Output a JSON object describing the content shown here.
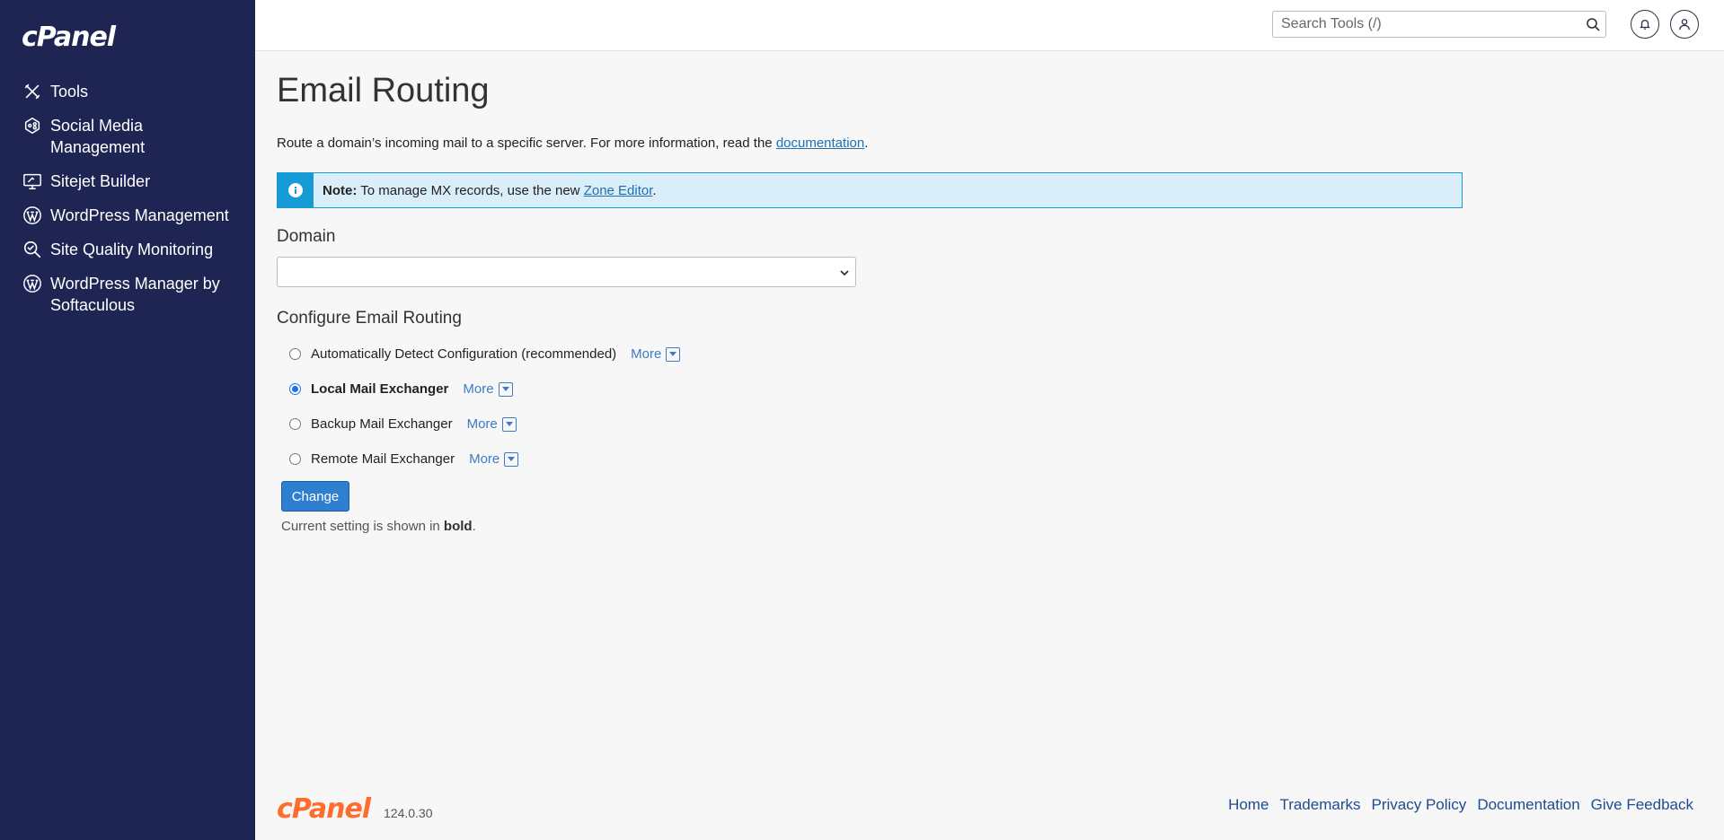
{
  "sidebar": {
    "brand": "cPanel",
    "items": [
      {
        "label": "Tools",
        "icon": "tools-icon"
      },
      {
        "label": "Social Media Management",
        "icon": "social-media-icon"
      },
      {
        "label": "Sitejet Builder",
        "icon": "sitejet-icon"
      },
      {
        "label": "WordPress Management",
        "icon": "wordpress-icon"
      },
      {
        "label": "Site Quality Monitoring",
        "icon": "site-quality-icon"
      },
      {
        "label": "WordPress Manager by Softaculous",
        "icon": "wordpress-icon"
      }
    ]
  },
  "topbar": {
    "search_placeholder": "Search Tools (/)",
    "search_value": ""
  },
  "main": {
    "title": "Email Routing",
    "intro_text": "Route a domain’s incoming mail to a specific server. For more information, read the ",
    "intro_link": "documentation",
    "intro_end": ".",
    "note": {
      "label": "Note:",
      "text": " To manage MX records, use the new ",
      "link": "Zone Editor",
      "end": "."
    },
    "domain_label": "Domain",
    "domain_value": "",
    "configure_title": "Configure Email Routing",
    "options": [
      {
        "label": "Automatically Detect Configuration (recommended)",
        "more": "More",
        "checked": false
      },
      {
        "label": "Local Mail Exchanger",
        "more": "More",
        "checked": true
      },
      {
        "label": "Backup Mail Exchanger",
        "more": "More",
        "checked": false
      },
      {
        "label": "Remote Mail Exchanger",
        "more": "More",
        "checked": false
      }
    ],
    "change_button": "Change",
    "hint_prefix": "Current setting is shown in ",
    "hint_bold": "bold",
    "hint_end": "."
  },
  "footer": {
    "brand": "cPanel",
    "version": "124.0.30",
    "links": [
      "Home",
      "Trademarks",
      "Privacy Policy",
      "Documentation",
      "Give Feedback"
    ]
  },
  "colors": {
    "sidebar_bg": "#1f2553",
    "accent": "#179bd7",
    "button": "#2f7fd0",
    "brand_orange": "#ff6c2c"
  }
}
